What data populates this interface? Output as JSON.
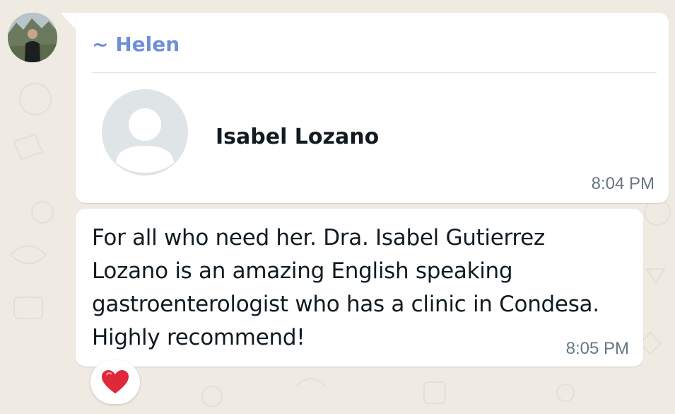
{
  "group_message": {
    "sender": "~ Helen",
    "contact_card": {
      "name": "Isabel Lozano",
      "time": "8:04 PM"
    },
    "text_message": {
      "lines": [
        "For all who need her. Dra. Isabel Gutierrez",
        "Lozano is an amazing English speaking",
        "gastroenterologist who has a clinic in Condesa.",
        "Highly recommend!"
      ],
      "time": "8:05 PM"
    },
    "reaction": {
      "icon": "red-heart-icon"
    }
  },
  "colors": {
    "chat_background": "#efeae2",
    "bubble": "#ffffff",
    "sender_name": "#6e8fd8",
    "timestamp": "#667781",
    "text": "#111b21",
    "placeholder_avatar": "#dfe5e7",
    "heart": "#e0283a"
  }
}
